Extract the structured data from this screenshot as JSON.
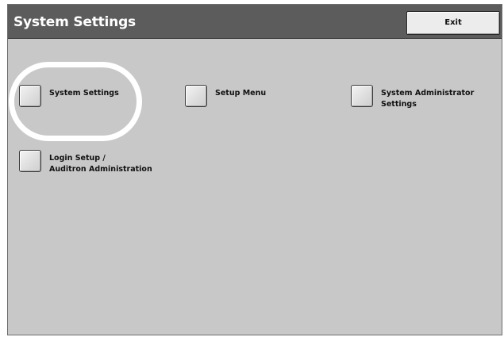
{
  "header": {
    "title": "System Settings",
    "exit_label": "Exit"
  },
  "options": [
    {
      "line1": "System Settings",
      "line2": ""
    },
    {
      "line1": "Setup Menu",
      "line2": ""
    },
    {
      "line1": "System Administrator",
      "line2": "Settings"
    },
    {
      "line1": "Login Setup /",
      "line2": "Auditron Administration"
    }
  ],
  "colors": {
    "header_bg": "#5c5c5c",
    "panel_bg": "#c8c8c8",
    "highlight_ring": "#ffffff"
  }
}
